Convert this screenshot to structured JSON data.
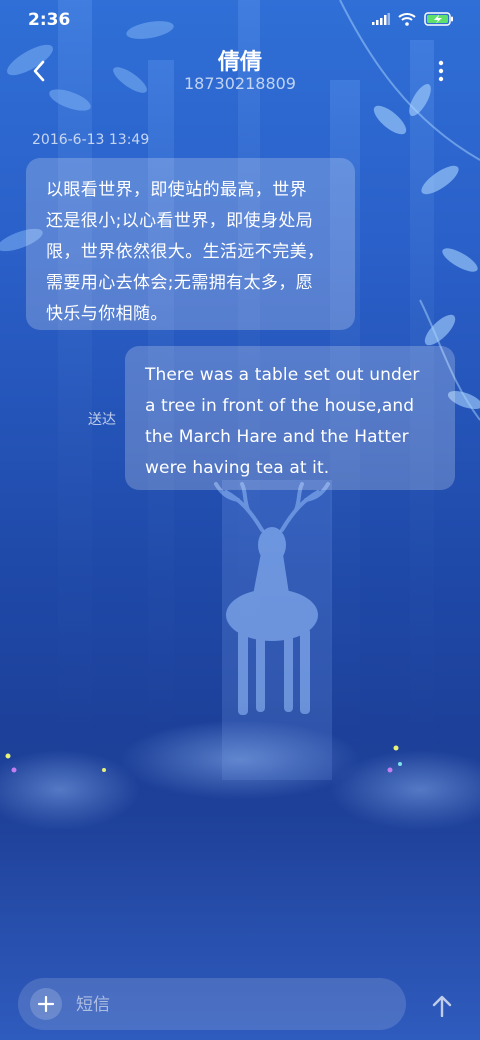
{
  "status_bar": {
    "time": "2:36",
    "icons": [
      "signal-icon",
      "wifi-icon",
      "battery-charging-icon"
    ],
    "battery_color": "#5ee06a"
  },
  "header": {
    "contact_name": "倩倩",
    "contact_number": "18730218809",
    "back_icon": "chevron-left-icon",
    "more_icon": "more-vertical-icon"
  },
  "conversation": {
    "timestamp": "2016-6-13 13:49",
    "incoming": {
      "lines": [
        "以眼看世界，即使站的最高，世界",
        "还是很小;以心看世界，即使身处局",
        "限，世界依然很大。生活远不完美，",
        "需要用心去体会;无需拥有太多，愿",
        "快乐与你相随。"
      ]
    },
    "outgoing": {
      "status": "送达",
      "lines": [
        "There was a table set out under",
        "a tree in front of the house,and",
        "the March Hare and the Hatter",
        "were having tea at it."
      ]
    }
  },
  "composer": {
    "placeholder": "短信",
    "add_icon": "plus-icon",
    "send_icon": "arrow-up-icon"
  },
  "theme": {
    "bubble_color": "rgba(255,255,255,0.22)",
    "background_top": "#2f6fd6",
    "background_bottom": "#1b3c93"
  }
}
